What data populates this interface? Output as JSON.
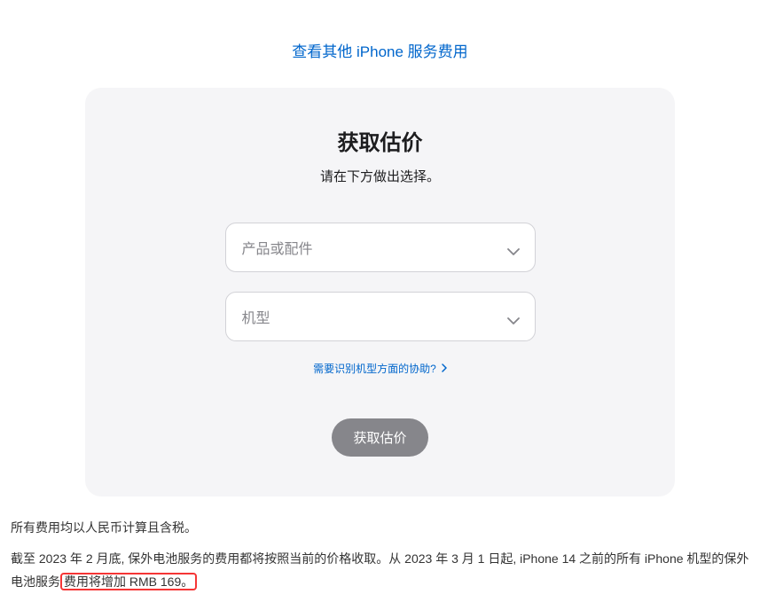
{
  "topLink": {
    "label": "查看其他 iPhone 服务费用"
  },
  "card": {
    "title": "获取估价",
    "subtitle": "请在下方做出选择。",
    "select1": {
      "placeholder": "产品或配件"
    },
    "select2": {
      "placeholder": "机型"
    },
    "helpLink": "需要识别机型方面的协助?",
    "submitButton": "获取估价"
  },
  "footer": {
    "line1": "所有费用均以人民币计算且含税。",
    "line2_prefix": "截至 2023 年 2 月底, 保外电池服务的费用都将按照当前的价格收取。从 2023 年 3 月 1 日起, iPhone 14 之前的所有 iPhone 机型的保外电池服务",
    "line2_highlight": "费用将增加 RMB 169。"
  }
}
